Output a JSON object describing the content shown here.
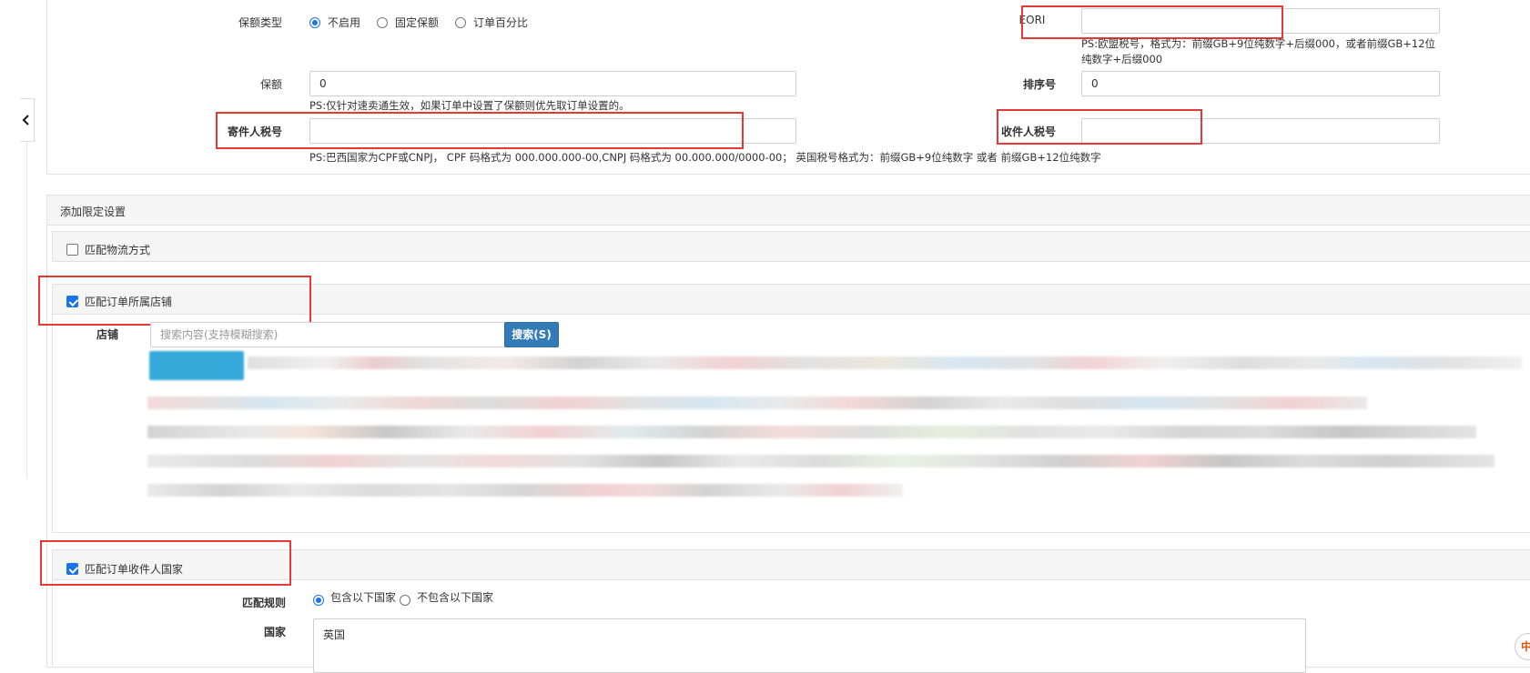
{
  "collapse_toggle": {
    "icon": "chevron-left-icon"
  },
  "insurance": {
    "type_label": "保额类型",
    "type_options": [
      {
        "label": "不启用",
        "selected": true
      },
      {
        "label": "固定保额",
        "selected": false
      },
      {
        "label": "订单百分比",
        "selected": false
      }
    ],
    "amount_label": "保额",
    "amount_value": "0",
    "amount_hint": "PS:仅针对速卖通生效，如果订单中设置了保额则优先取订单设置的。"
  },
  "eori": {
    "label": "EORI",
    "value": "",
    "hint_line1": "PS:欧盟税号，格式为：前缀GB+9位纯数字+后缀000，或者前缀GB+12位",
    "hint_line2": "纯数字+后缀000"
  },
  "sort": {
    "label": "排序号",
    "value": "0"
  },
  "sender_tax": {
    "label": "寄件人税号",
    "value": ""
  },
  "receiver_tax": {
    "label": "收件人税号",
    "value": ""
  },
  "tax_hint": "PS:巴西国家为CPF或CNPJ， CPF 码格式为 000.000.000-00,CNPJ 码格式为 00.000.000/0000-00； 英国税号格式为：前缀GB+9位纯数字 或者 前缀GB+12位纯数字",
  "limits": {
    "title": "添加限定设置",
    "match_logistics": {
      "label": "匹配物流方式",
      "checked": false
    },
    "match_store": {
      "label": "匹配订单所属店铺",
      "checked": true,
      "store_label": "店铺",
      "search_placeholder": "搜索内容(支持模糊搜索)",
      "search_button": "搜索(S)"
    },
    "match_country": {
      "label": "匹配订单收件人国家",
      "checked": true,
      "rule_label": "匹配规则",
      "rule_options": [
        {
          "label": "包含以下国家",
          "selected": true
        },
        {
          "label": "不包含以下国家",
          "selected": false
        }
      ],
      "country_label": "国家",
      "country_value": "英国"
    }
  },
  "colors": {
    "accent": "#337ab7",
    "highlight": "#e53935",
    "check": "#1a73e8"
  }
}
